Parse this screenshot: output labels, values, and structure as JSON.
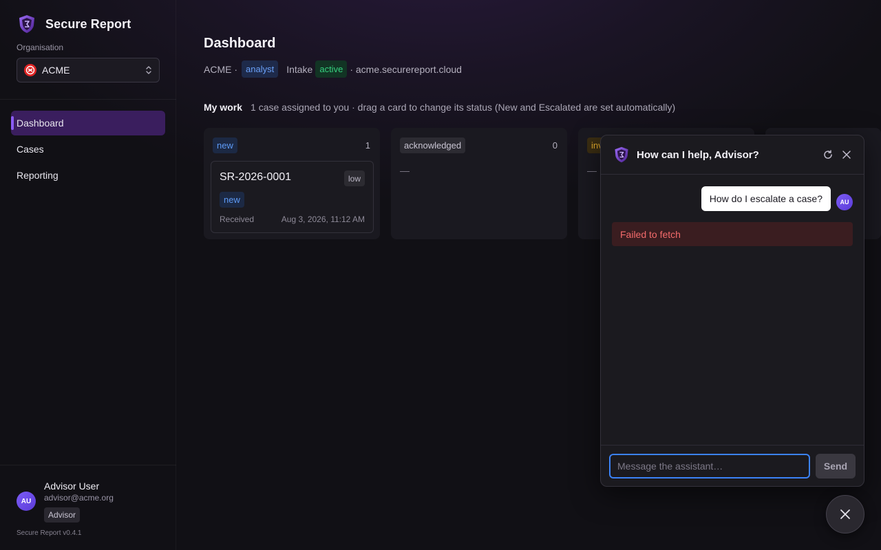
{
  "brand": {
    "name": "Secure Report",
    "icon": "shield-logo-icon"
  },
  "organisation": {
    "label": "Organisation",
    "selected": "ACME",
    "icon": "acme-logo-icon"
  },
  "nav": {
    "items": [
      {
        "label": "Dashboard",
        "active": true
      },
      {
        "label": "Cases",
        "active": false
      },
      {
        "label": "Reporting",
        "active": false
      }
    ]
  },
  "user": {
    "initials": "AU",
    "name": "Advisor User",
    "email": "advisor@acme.org",
    "role": "Advisor"
  },
  "version": "Secure Report v0.4.1",
  "page": {
    "title": "Dashboard",
    "org": "ACME ·",
    "role_badge": "analyst",
    "intake_label": "Intake",
    "intake_status": "active",
    "domain": "· acme.securereport.cloud"
  },
  "my_work": {
    "title": "My work",
    "subtitle": "1 case assigned to you · drag a card to change its status (New and Escalated are set automatically)"
  },
  "board": {
    "columns": [
      {
        "tag": "new",
        "count": "1"
      },
      {
        "tag": "acknowledged",
        "count": "0",
        "empty": "—"
      },
      {
        "tag": "investigating",
        "count": "",
        "empty": "—"
      }
    ],
    "case": {
      "id": "SR-2026-0001",
      "severity": "low",
      "status": "new",
      "received_label": "Received",
      "received_date": "Aug 3, 2026, 11:12 AM"
    }
  },
  "chat": {
    "title": "How can I help, Advisor?",
    "user_message": "How do I escalate a case?",
    "user_initials": "AU",
    "error": "Failed to fetch",
    "input_placeholder": "Message the assistant…",
    "send_label": "Send"
  },
  "colors": {
    "accent": "#8b5cf6",
    "nav_active_bg": "#3a1e5e",
    "info": "#5e9af5",
    "success": "#36d07f",
    "warning": "#e0a92c",
    "error": "#f36b6b",
    "focus": "#3b82f6"
  }
}
